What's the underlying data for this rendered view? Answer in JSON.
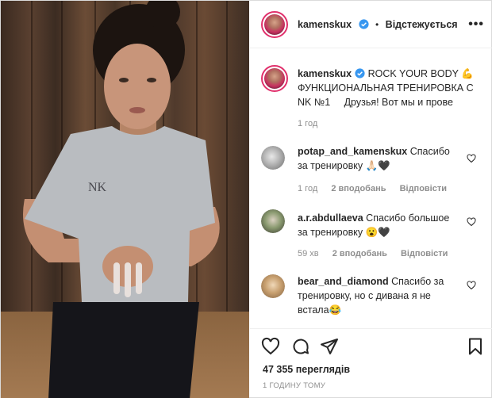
{
  "header": {
    "username": "kamenskux",
    "follow_status": "Відстежується",
    "separator": "•"
  },
  "caption": {
    "username": "kamenskux",
    "line1": "ROCK YOUR BODY 💪",
    "line2": "ФУНКЦИОНАЛЬНАЯ ТРЕНИРОВКА С",
    "line3": "NK №1     Друзья! Вот мы и прове",
    "time": "1 год"
  },
  "comments": [
    {
      "username": "potap_and_kamenskux",
      "text1": "Спасибо",
      "text2": "за тренировку 🙏🏻🖤",
      "time": "1 год",
      "likes": "2 вподобань",
      "reply": "Відповісти"
    },
    {
      "username": "a.r.abdullaeva",
      "text1": "Спасибо большое",
      "text2": "за тренировку 😮🖤",
      "time": "59 хв",
      "likes": "2 вподобань",
      "reply": "Відповісти"
    },
    {
      "username": "bear_and_diamond",
      "text1": "Спасибо за",
      "text2": "тренировку, но с дивана я не",
      "text3": "встала😂"
    }
  ],
  "stats": {
    "views": "47 355 переглядів",
    "posted": "1 ГОДИНУ ТОМУ"
  },
  "icons": {
    "like": "heart-icon",
    "comment": "comment-icon",
    "share": "share-icon",
    "save": "bookmark-icon",
    "more": "more-icon",
    "verified": "verified-badge-icon"
  },
  "colors": {
    "verified": "#3897f0",
    "text": "#262626",
    "muted": "#8e8e8e",
    "story_ring": "#e1306c"
  }
}
